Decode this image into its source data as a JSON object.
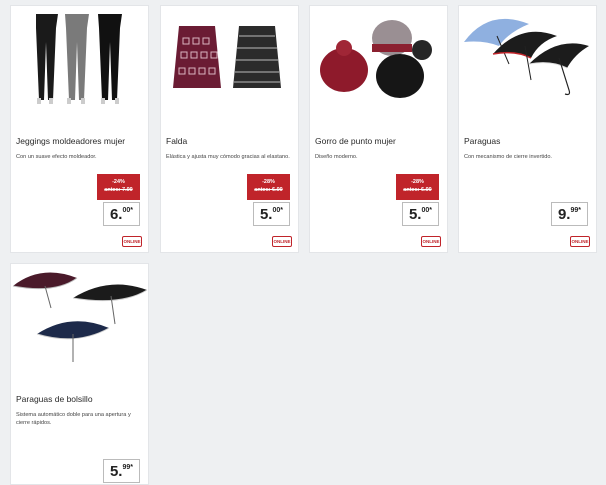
{
  "products": [
    {
      "title": "Jeggings moldeadores mujer",
      "description": "Con un suave efecto moldeador.",
      "discount": "-24%",
      "old_price": "antes: 7.99",
      "price_whole": "6.",
      "price_cents": "00*",
      "badge": "ONLINE"
    },
    {
      "title": "Falda",
      "description": "Elástica y ajusta muy cómodo gracias al elastano.",
      "discount": "-28%",
      "old_price": "antes: 6.99",
      "price_whole": "5.",
      "price_cents": "00*",
      "badge": "ONLINE"
    },
    {
      "title": "Gorro de punto mujer",
      "description": "Diseño moderno.",
      "discount": "-28%",
      "old_price": "antes: 6.99",
      "price_whole": "5.",
      "price_cents": "00*",
      "badge": "ONLINE"
    },
    {
      "title": "Paraguas",
      "description": "Con mecanismo de cierre invertido.",
      "price_whole": "9.",
      "price_cents": "99*",
      "badge": "ONLINE"
    },
    {
      "title": "Paraguas de bolsillo",
      "description": "Sistema automático doble para una apertura y cierre rápidos.",
      "price_whole": "5.",
      "price_cents": "99*"
    }
  ],
  "colors": {
    "accent_red": "#c0242a",
    "card_bg": "#ffffff",
    "page_bg": "#eef0f2"
  }
}
